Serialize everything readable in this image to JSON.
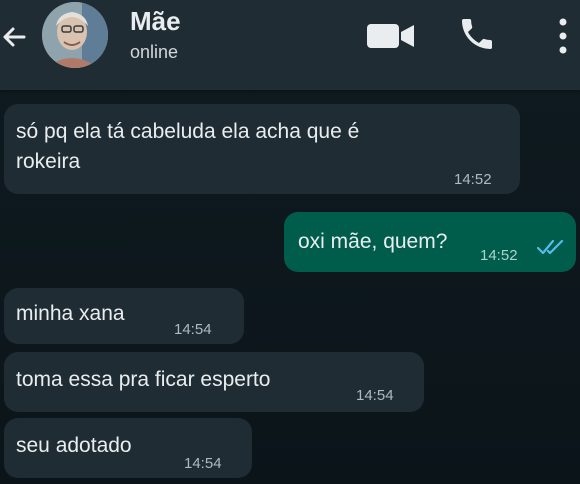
{
  "header": {
    "contact_name": "Mãe",
    "status": "online",
    "icons": {
      "back": "arrow-left-icon",
      "video": "video-camera-icon",
      "call": "phone-icon",
      "menu": "more-vertical-icon"
    }
  },
  "colors": {
    "header_bg": "#1f2c33",
    "chat_bg": "#0b141a",
    "incoming_bubble": "#1f2c33",
    "outgoing_bubble": "#005c4b",
    "read_ticks": "#53bdeb"
  },
  "messages": [
    {
      "direction": "incoming",
      "text_line1": "só pq ela tá cabeluda ela acha que é",
      "text_line2": "rokeira",
      "time": "14:52"
    },
    {
      "direction": "outgoing",
      "text": "oxi mãe, quem?",
      "time": "14:52",
      "status": "read"
    },
    {
      "direction": "incoming",
      "text": "minha xana",
      "time": "14:54"
    },
    {
      "direction": "incoming",
      "text": "toma essa pra ficar esperto",
      "time": "14:54"
    },
    {
      "direction": "incoming",
      "text": "seu adotado",
      "time": "14:54"
    }
  ]
}
